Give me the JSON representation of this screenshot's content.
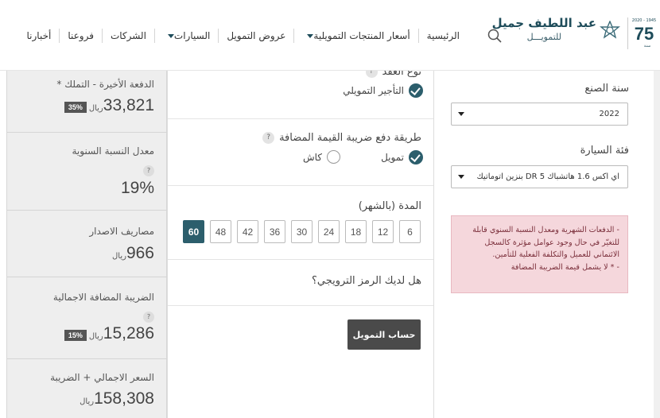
{
  "header": {
    "logo": {
      "line1": "عبد اللطيف جميل",
      "line2": "للتمويـــل",
      "mark_years": "1945 - 2020",
      "mark_number": "75",
      "mark_sub": "سنة"
    },
    "nav": [
      {
        "label": "الرئيسية",
        "caret": false
      },
      {
        "label": "أسعار المنتجات التمويلية",
        "caret": true
      },
      {
        "label": "عروض التمويل",
        "caret": false
      },
      {
        "label": "السيارات",
        "caret": true
      },
      {
        "label": "الشركات",
        "caret": false
      },
      {
        "label": "فروعنا",
        "caret": false
      },
      {
        "label": "أخبارنا",
        "caret": false
      }
    ]
  },
  "summary": {
    "final_payment": {
      "label": "الدفعة الأخيرة - التملك *",
      "value": "33,821",
      "unit": "ريال",
      "badge": "35%"
    },
    "apr": {
      "label": "معدل النسبة السنوية",
      "help": "?",
      "value": "19%"
    },
    "admin_fees": {
      "label": "مصاريف الاصدار",
      "value": "966",
      "unit": "ريال"
    },
    "total_vat": {
      "label": "الضريبة المضافة الاجمالية",
      "help": "?",
      "value": "15,286",
      "unit": "ريال",
      "badge": "15%"
    },
    "total_price": {
      "label": "السعر الاجمالي + الضريبة",
      "value": "158,308",
      "unit": "ريال"
    }
  },
  "form": {
    "contract_type": {
      "title": "نوع العقد",
      "help": "?",
      "option": "التأجير التمويلي"
    },
    "vat_payment": {
      "title": "طريقة دفع ضريبة القيمة المضافة",
      "help": "?",
      "option_selected": "تمويل",
      "option_other": "كاش"
    },
    "duration": {
      "title": "المدة (بالشهر)",
      "options": [
        "6",
        "12",
        "18",
        "24",
        "30",
        "36",
        "42",
        "48",
        "60"
      ],
      "selected": "60"
    },
    "promo": {
      "title": "هل لديك الرمز الترويجي؟"
    },
    "calculate_label": "حساب التمويل"
  },
  "right": {
    "year_label": "سنة الصنع",
    "year_value": "2022",
    "category_label": "فئة السيارة",
    "category_value": "اي اكس 1.6 هاتشباك DR 5 بنزين اتوماتيك",
    "note_line1": "- الدفعات الشهرية ومعدل النسبة السنوي قابلة للتغيّر في حال وجود عوامل مؤثرة كالسجل الائتماني للعميل والتكلفة الفعلية للتأمين.",
    "note_line2": "- * لا يشمل قيمة الضريبة المضافة"
  },
  "colors": {
    "accent": "#2c5e6c",
    "summary_bg": "#eeeeee",
    "note_bg": "#f5d7dc",
    "note_text": "#7a2e3a",
    "button_bg": "#4a4a4a"
  }
}
